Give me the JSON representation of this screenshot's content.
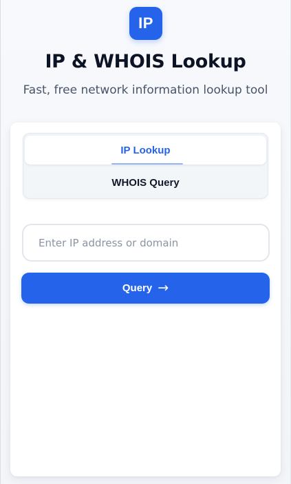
{
  "header": {
    "logo_text": "IP",
    "title": "IP & WHOIS Lookup",
    "subtitle": "Fast, free network information lookup tool"
  },
  "tabs": [
    {
      "label": "IP Lookup",
      "active": true
    },
    {
      "label": "WHOIS Query",
      "active": false
    }
  ],
  "search": {
    "placeholder": "Enter IP address or domain",
    "value": ""
  },
  "query_button": {
    "label": "Query",
    "icon": "arrow-right-icon",
    "arrow_glyph": "→"
  },
  "colors": {
    "accent": "#2563eb",
    "title": "#0b1324",
    "subtitle": "#475569"
  }
}
